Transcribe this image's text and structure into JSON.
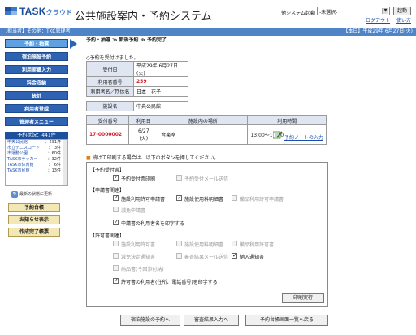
{
  "header": {
    "logo_text": "TASK",
    "logo_sub": "クラウド",
    "title": "公共施設案内・予約システム",
    "select_label": "他システム起動",
    "select_value": "-未選択-",
    "start_label": "起動",
    "logout_label": "ログアウト",
    "help_label": "使い方"
  },
  "infobar": {
    "left": "【担当者】その他：TKC管理者",
    "right": "【本日】平成29年 6月27日(火)"
  },
  "sidebar": {
    "items": [
      {
        "label": "予約・抽選",
        "active": true
      },
      {
        "label": "宿泊施設予約"
      },
      {
        "label": "利用実績入力"
      },
      {
        "label": "料金収納"
      },
      {
        "label": "統計"
      },
      {
        "label": "利用者登録"
      },
      {
        "label": "管理者メニュー"
      }
    ],
    "answer_head": "予約状況：441件",
    "answers": [
      {
        "name": "中央公民館",
        "count": "：291件"
      },
      {
        "name": "市立テニスコート",
        "count": "：　3件"
      },
      {
        "name": "市運動公園",
        "count": "：60件"
      },
      {
        "name": "TASK市サッカー",
        "count": "：32件"
      },
      {
        "name": "TASK市体育館",
        "count": "：　6件"
      },
      {
        "name": "TASK市民館",
        "count": "：13件"
      }
    ],
    "refresh_label": "最新の状態に更新",
    "bottom_buttons": [
      "予約台帳",
      "お知らせ表示",
      "作成完了帳票"
    ]
  },
  "main": {
    "breadcrumb": [
      "予約・抽選",
      "新規予約",
      "予約完了"
    ],
    "done_message": "◇予約を受付けました。",
    "accept_date_label": "受付日",
    "accept_date": "平成29年 6月27日(火)",
    "user_no_label": "利用者番号",
    "user_no": "259",
    "user_name_label": "利用者名／団体名",
    "user_name": "日本　花子",
    "facility_label": "施設名",
    "facility": "中央公民館",
    "result_headers": [
      "受付番号",
      "利用日",
      "施設内の場所",
      "利用時間"
    ],
    "result_row": {
      "no": "17-0000002",
      "date": "6/27\n(火)",
      "place": "音楽室",
      "time": "13:00～17:00"
    },
    "memo_label": "予約ノートの入力",
    "note": "続けて印刷する場合は、以下のボタンを押してください。",
    "print": {
      "sec1": "【予約受付書】",
      "sec2": "【申請書関連】",
      "sec3": "【許可書関連】",
      "opt_receipt": "予約受付票印刷",
      "opt_receipt_mail": "予約受付メール送信",
      "opt_app1": "施設利用許可申請書",
      "opt_app2": "施設使用料明細書",
      "opt_app3": "備品利用許可申請書",
      "opt_app4": "減免申請書",
      "opt_app_print": "申請書の利用者名を印字する",
      "opt_perm1": "施設利用許可書",
      "opt_perm2": "施設使用料明細書",
      "opt_perm3": "備品利用許可書",
      "opt_perm4": "減免決定通知書",
      "opt_perm5": "審査結果メール送信",
      "opt_perm6": "納入通知書",
      "opt_perm7": "納品書(今回添付納)",
      "opt_perm_print": "許可書の利用者(住所、電話番号)を印字する",
      "print_btn": "印刷実行"
    },
    "bottom_buttons": [
      "宿泊施設の予約へ",
      "審査結果入力へ",
      "予約台帳画面一覧へ戻る"
    ]
  },
  "colors": {
    "brand": "#2e63b4",
    "infobar": "#4f84c8",
    "red": "#d8202a"
  }
}
